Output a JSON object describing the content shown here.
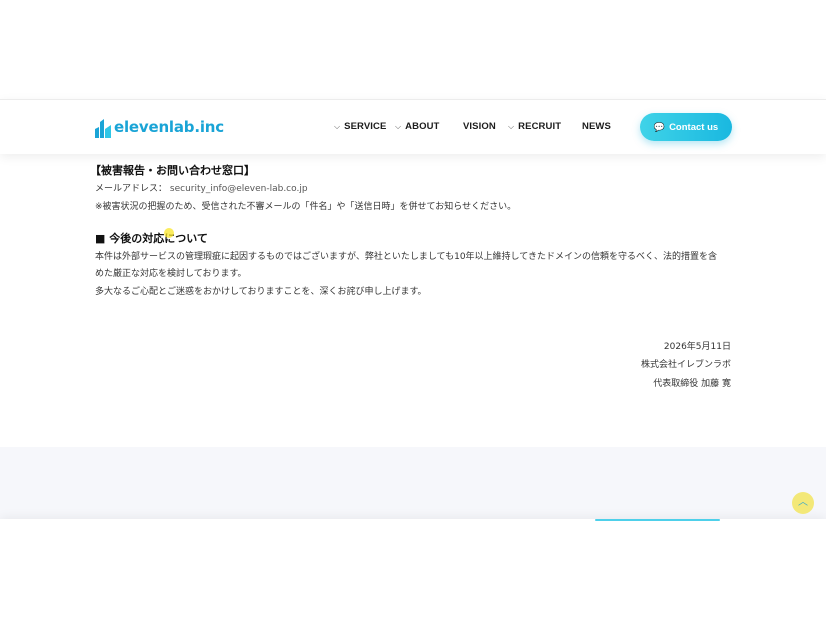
{
  "header": {
    "logo_text": "elevenlab.inc",
    "nav": [
      {
        "label": "SERVICE",
        "dropdown": true
      },
      {
        "label": "ABOUT",
        "dropdown": true
      },
      {
        "label": "VISION",
        "dropdown": false
      },
      {
        "label": "RECRUIT",
        "dropdown": true
      },
      {
        "label": "NEWS",
        "dropdown": false
      }
    ],
    "contact_label": "Contact us"
  },
  "content": {
    "report_heading": "【被害報告・お問い合わせ窓口】",
    "email_label": "メールアドレス：",
    "email_value": "security_info@eleven-lab.co.jp",
    "report_note": "※被害状況の把握のため、受信された不審メールの「件名」や「送信日時」を併せてお知らせください。",
    "section_heading": "■ 今後の対応について",
    "paragraph_1": "本件は外部サービスの管理瑕疵に起因するものではございますが、弊社といたしましても10年以上維持してきたドメインの信頼を守るべく、法的措置を含",
    "paragraph_1_cont": "めた厳正な対応を検討しております。",
    "paragraph_2": "多大なるご心配とご迷惑をおかけしておりますことを、深くお詫び申し上げます。",
    "date": "2026年5月11日",
    "company": "株式会社イレブンラボ",
    "representative": "代表取締役 加藤 寛"
  },
  "colors": {
    "accent": "#1aa4d6",
    "button_gradient_start": "#3fd3e8",
    "button_gradient_end": "#1ab8e0"
  },
  "icons": {
    "logo": "elevenlab-logo-icon",
    "chevron": "chevron-down-icon",
    "chat": "chat-bubble-icon",
    "back_to_top": "arrow-up-icon"
  }
}
